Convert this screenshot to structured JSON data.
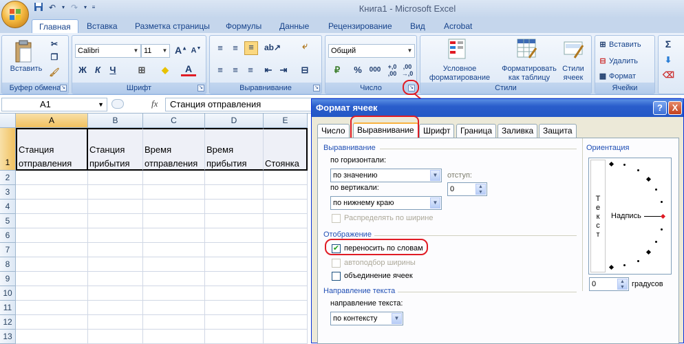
{
  "window": {
    "title": "Книга1 - Microsoft Excel"
  },
  "tabs": [
    {
      "label": "Главная"
    },
    {
      "label": "Вставка"
    },
    {
      "label": "Разметка страницы"
    },
    {
      "label": "Формулы"
    },
    {
      "label": "Данные"
    },
    {
      "label": "Рецензирование"
    },
    {
      "label": "Вид"
    },
    {
      "label": "Acrobat"
    }
  ],
  "ribbon": {
    "clipboard": {
      "label": "Буфер обмена",
      "paste": "Вставить"
    },
    "font": {
      "label": "Шрифт",
      "name": "Calibri",
      "size": "11",
      "bold": "Ж",
      "italic": "К",
      "underline": "Ч"
    },
    "alignment": {
      "label": "Выравнивание"
    },
    "number": {
      "label": "Число",
      "format": "Общий",
      "percent": "%",
      "thousands": "000"
    },
    "styles": {
      "label": "Стили",
      "conditional": "Условное",
      "conditional2": "форматирование",
      "table": "Форматировать",
      "table2": "как таблицу",
      "cellstyles": "Стили",
      "cellstyles2": "ячеек"
    },
    "cells": {
      "label": "Ячейки",
      "insert": "Вставить",
      "delete": "Удалить",
      "format": "Формат"
    },
    "editing": {
      "sigma": "Σ"
    }
  },
  "formula_bar": {
    "name_box": "A1",
    "fx": "fx",
    "value": "Станция отправления"
  },
  "sheet": {
    "columns": [
      "A",
      "B",
      "C",
      "D",
      "E"
    ],
    "rows": [
      "1",
      "2",
      "3",
      "4",
      "5",
      "6",
      "7",
      "8",
      "9",
      "10",
      "11",
      "12",
      "13"
    ],
    "row1": [
      {
        "l1": "Станция",
        "l2": "отправления"
      },
      {
        "l1": "Станция",
        "l2": "прибытия"
      },
      {
        "l1": "Время",
        "l2": "отправления"
      },
      {
        "l1": "Время",
        "l2": "прибытия"
      },
      {
        "l1": "",
        "l2": "Стоянка"
      }
    ]
  },
  "dialog": {
    "title": "Формат ячеек",
    "help": "?",
    "close": "X",
    "tabs": [
      "Число",
      "Выравнивание",
      "Шрифт",
      "Граница",
      "Заливка",
      "Защита"
    ],
    "alignment_section": "Выравнивание",
    "horizontal_label": "по горизонтали:",
    "horizontal_value": "по значению",
    "indent_label": "отступ:",
    "indent_value": "0",
    "vertical_label": "по вертикали:",
    "vertical_value": "по нижнему краю",
    "distribute_label": "Распределять по ширине",
    "display_section": "Отображение",
    "wrap_label": "переносить по словам",
    "wrap_checked": true,
    "shrink_label": "автоподбор ширины",
    "merge_label": "объединение ячеек",
    "direction_section": "Направление текста",
    "direction_label": "направление текста:",
    "direction_value": "по контексту",
    "orientation_section": "Ориентация",
    "vertical_text": "Т\nе\nк\nс\nт",
    "inscription": "Надпись",
    "degrees_value": "0",
    "degrees_label": "градусов"
  }
}
